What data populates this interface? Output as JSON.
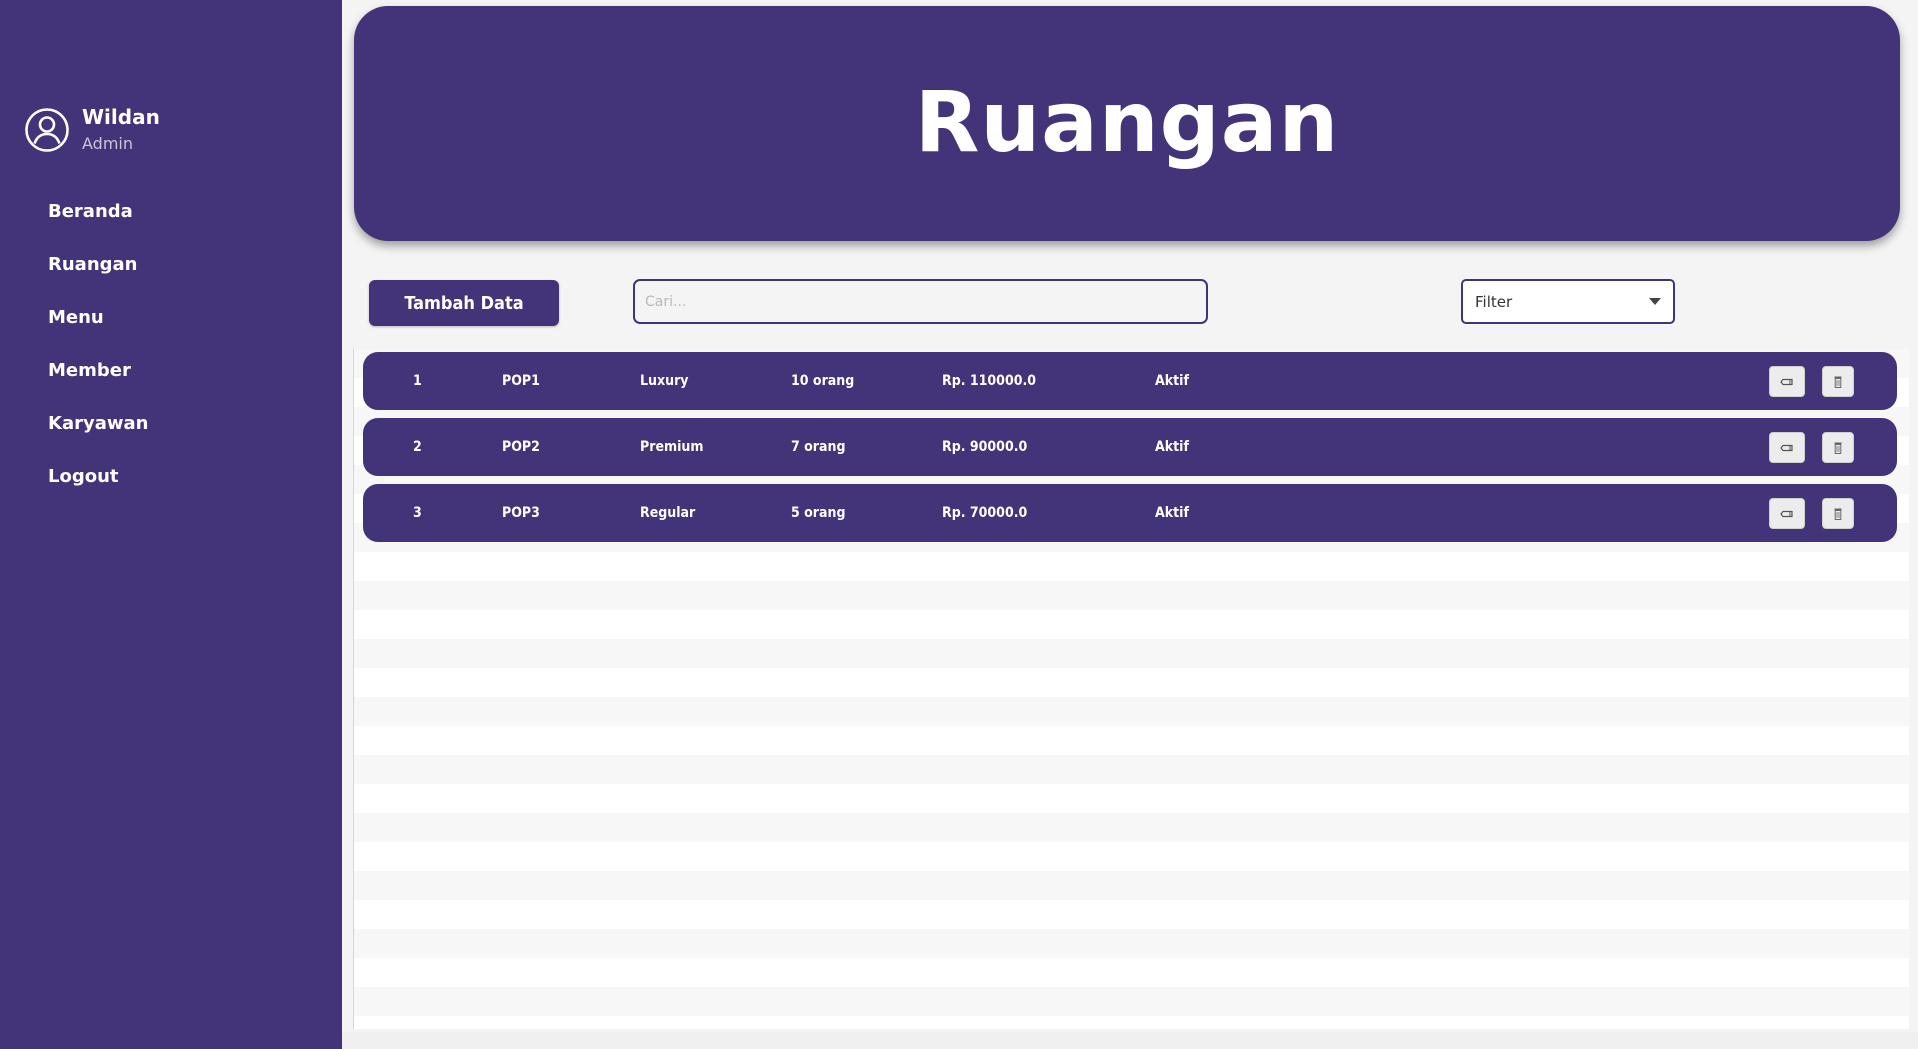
{
  "sidebar": {
    "user": {
      "name": "Wildan",
      "role": "Admin",
      "icon": "user-circle-icon"
    },
    "nav": [
      {
        "label": "Beranda"
      },
      {
        "label": "Ruangan"
      },
      {
        "label": "Menu"
      },
      {
        "label": "Member"
      },
      {
        "label": "Karyawan"
      },
      {
        "label": "Logout"
      }
    ]
  },
  "header": {
    "title": "Ruangan"
  },
  "toolbar": {
    "add_label": "Tambah Data",
    "search_placeholder": "Cari...",
    "filter_label": "Filter"
  },
  "rows": [
    {
      "no": "1",
      "code": "POP1",
      "type": "Luxury",
      "capacity": "10 orang",
      "price": "Rp. 110000.0",
      "status": "Aktif"
    },
    {
      "no": "2",
      "code": "POP2",
      "type": "Premium",
      "capacity": "7 orang",
      "price": "Rp. 90000.0",
      "status": "Aktif"
    },
    {
      "no": "3",
      "code": "POP3",
      "type": "Regular",
      "capacity": "5 orang",
      "price": "Rp. 70000.0",
      "status": "Aktif"
    }
  ],
  "row_actions": {
    "edit_icon": "pencil-icon",
    "delete_icon": "trash-icon"
  },
  "colors": {
    "primary": "#433378",
    "background": "#f4f4f4",
    "text_on_primary": "#ffffff"
  }
}
